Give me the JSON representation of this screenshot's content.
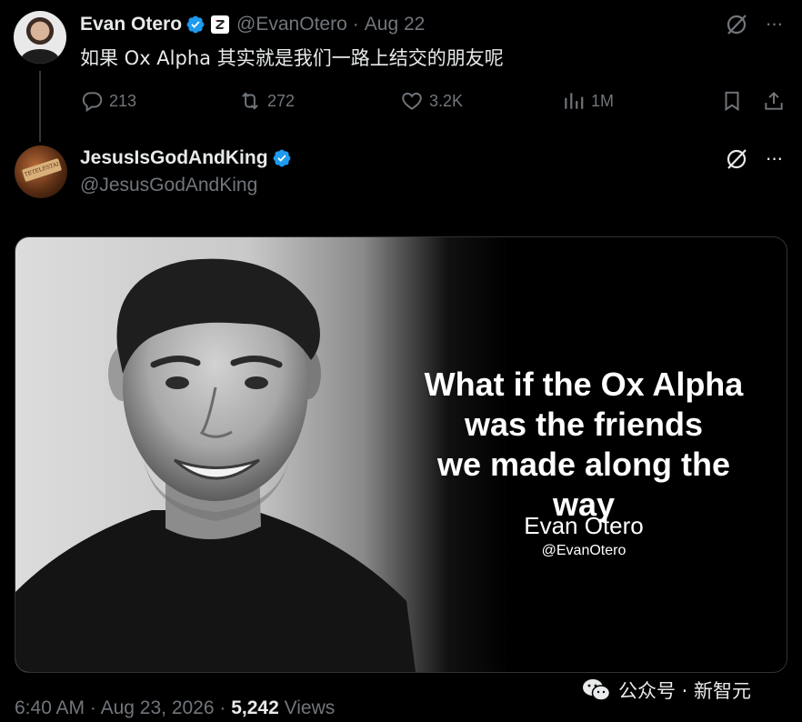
{
  "tweet1": {
    "name": "Evan Otero",
    "handle": "@EvanOtero",
    "separator": "·",
    "date": "Aug 22",
    "text": "如果 Ox Alpha 其实就是我们一路上结交的朋友呢",
    "replies": "213",
    "retweets": "272",
    "likes": "3.2K",
    "views": "1M",
    "more": "···"
  },
  "tweet2": {
    "name": "JesusIsGodAndKing",
    "handle": "@JesusGodAndKing",
    "avatar_text": "TETELESTAI",
    "more": "···",
    "image": {
      "quote_lines": [
        "What if the Ox Alpha",
        "was the friends",
        "we made along the way"
      ],
      "name": "Evan Otero",
      "handle": "@EvanOtero"
    }
  },
  "footer": {
    "time": "6:40 AM",
    "sep1": "·",
    "date": "Aug 23, 2026",
    "sep2": "·",
    "views_count": "5,242",
    "views_label": "Views"
  },
  "watermark": {
    "text": "公众号 · 新智元"
  },
  "colors": {
    "background": "#000000",
    "primary_text": "#e7e9ea",
    "secondary_text": "#71767b",
    "verified_blue": "#1d9bf0",
    "border": "#2f3336"
  }
}
